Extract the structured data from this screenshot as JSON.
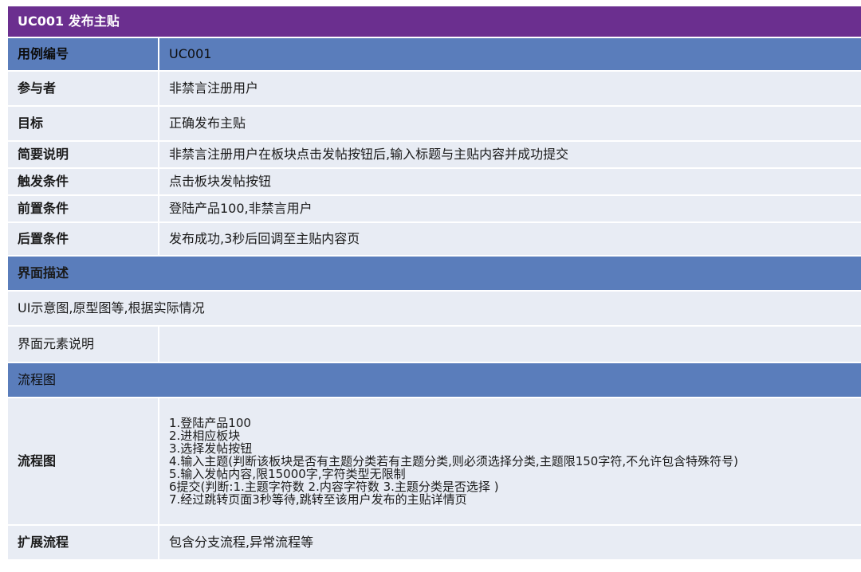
{
  "title": "UC001 发布主贴",
  "rows": {
    "id": {
      "label": "用例编号",
      "value": "UC001"
    },
    "actor": {
      "label": "参与者",
      "value": "非禁言注册用户"
    },
    "goal": {
      "label": "目标",
      "value": "正确发布主贴"
    },
    "summary": {
      "label": "简要说明",
      "value": "非禁言注册用户在板块点击发帖按钮后,输入标题与主贴内容并成功提交"
    },
    "trigger": {
      "label": "触发条件",
      "value": "点击板块发帖按钮"
    },
    "precondition": {
      "label": "前置条件",
      "value": "登陆产品100,非禁言用户"
    },
    "postcondition": {
      "label": "后置条件",
      "value": "发布成功,3秒后回调至主贴内容页"
    }
  },
  "interface_section": {
    "header": "界面描述",
    "ui_note": "UI示意图,原型图等,根据实际情况",
    "elements_label": "界面元素说明",
    "elements_value": ""
  },
  "flow_section": {
    "header": "流程图",
    "label": "流程图",
    "steps": [
      "1.登陆产品100",
      "2.进相应板块",
      "3.选择发帖按钮",
      "4.输入主题(判断该板块是否有主题分类若有主题分类,则必须选择分类,主题限150字符,不允许包含特殊符号)",
      "5.输入发帖内容,限15000字,字符类型无限制",
      "6提交(判断:1.主题字符数 2.内容字符数 3.主题分类是否选择 )",
      "7.经过跳转页面3秒等待,跳转至该用户发布的主贴详情页"
    ]
  },
  "extension": {
    "label": "扩展流程",
    "value": "包含分支流程,异常流程等"
  },
  "colors": {
    "title_bg": "#6b2f8f",
    "header_bg": "#5a7dbb",
    "row_bg": "#e8ecf4"
  }
}
